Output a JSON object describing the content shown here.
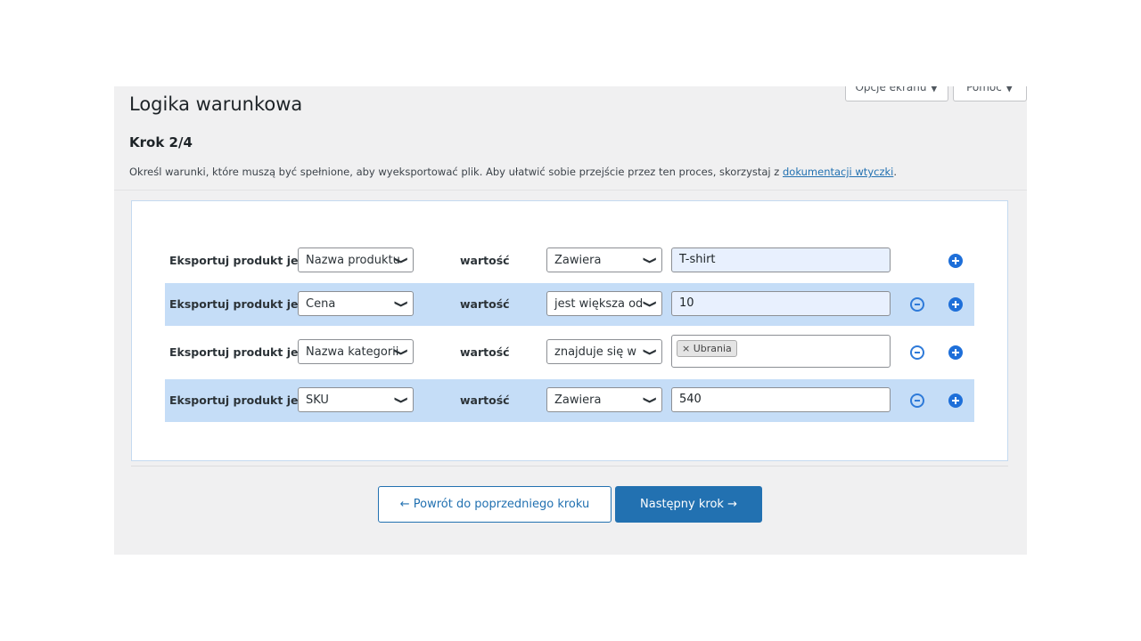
{
  "header": {
    "screen_options": "Opcje ekranu ▼",
    "help": "Pomoc ▼",
    "title": "Logika warunkowa",
    "step": "Krok 2/4",
    "description": "Określ warunki, które muszą być spełnione, aby wyeksportować plik. Aby ułatwić sobie przejście przez ten proces, skorzystaj z ",
    "doc_link": "dokumentacji wtyczki",
    "description_end": "."
  },
  "rows": [
    {
      "label": "Eksportuj produkt jeżeli",
      "field": "Nazwa produktu",
      "value_label": "wartość",
      "operator": "Zawiera",
      "value": "T-shirt",
      "highlighted": false
    },
    {
      "label": "Eksportuj produkt jeżeli",
      "field": "Cena",
      "value_label": "wartość",
      "operator": "jest większa od",
      "value": "10",
      "highlighted": true
    },
    {
      "label": "Eksportuj produkt jeżeli",
      "field": "Nazwa kategorii",
      "value_label": "wartość",
      "operator": "znajduje się w",
      "tag": "× Ubrania",
      "highlighted": false
    },
    {
      "label": "Eksportuj produkt jeżeli",
      "field": "SKU",
      "value_label": "wartość",
      "operator": "Zawiera",
      "value": "540",
      "highlighted": true
    }
  ],
  "footer": {
    "back": "← Powrót do poprzedniego kroku",
    "next": "Następny krok →"
  },
  "colors": {
    "accent": "#2271b1",
    "row_highlight": "#c5ddf7"
  }
}
